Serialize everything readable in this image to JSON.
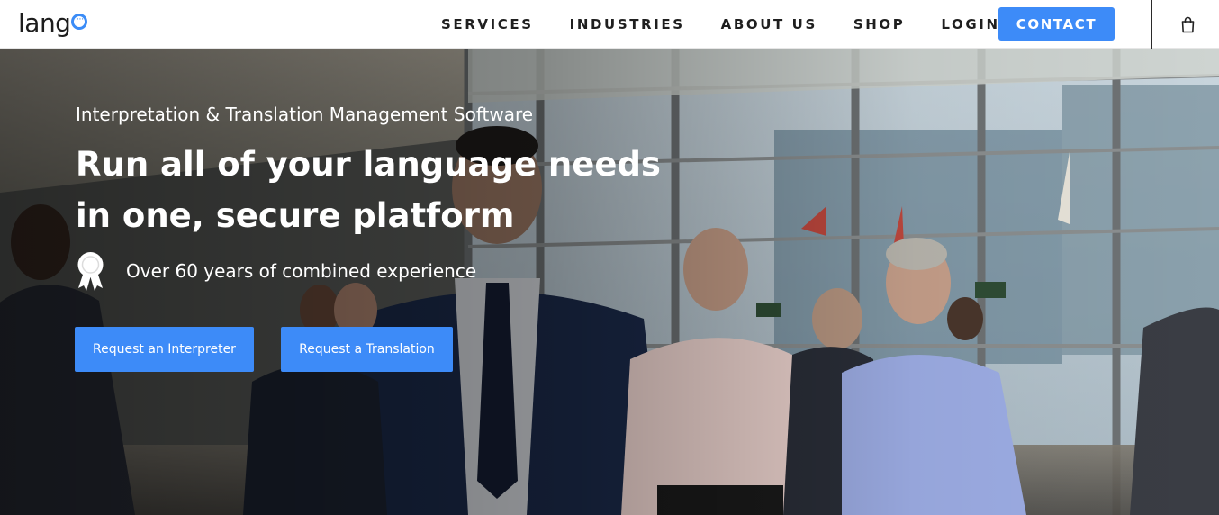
{
  "brand": {
    "logo_text": "lang"
  },
  "nav": {
    "items": [
      {
        "label": "SERVICES"
      },
      {
        "label": "INDUSTRIES"
      },
      {
        "label": "ABOUT US"
      },
      {
        "label": "SHOP"
      },
      {
        "label": "LOGIN"
      }
    ],
    "contact_label": "CONTACT",
    "cart_icon": "shopping-bag-icon"
  },
  "hero": {
    "subtitle": "Interpretation & Translation Management Software",
    "headline_line1": "Run all of your language needs",
    "headline_line2": "in one, secure platform",
    "badge_icon": "award-ribbon-icon",
    "badge_text": "Over 60 years of combined experience",
    "cta_primary": "Request an Interpreter",
    "cta_secondary": "Request a Translation",
    "background": "photo of business people walking in a glass office lobby"
  },
  "colors": {
    "accent": "#3d8bf8",
    "nav_text": "#1f1f1f",
    "hero_text": "#ffffff"
  }
}
